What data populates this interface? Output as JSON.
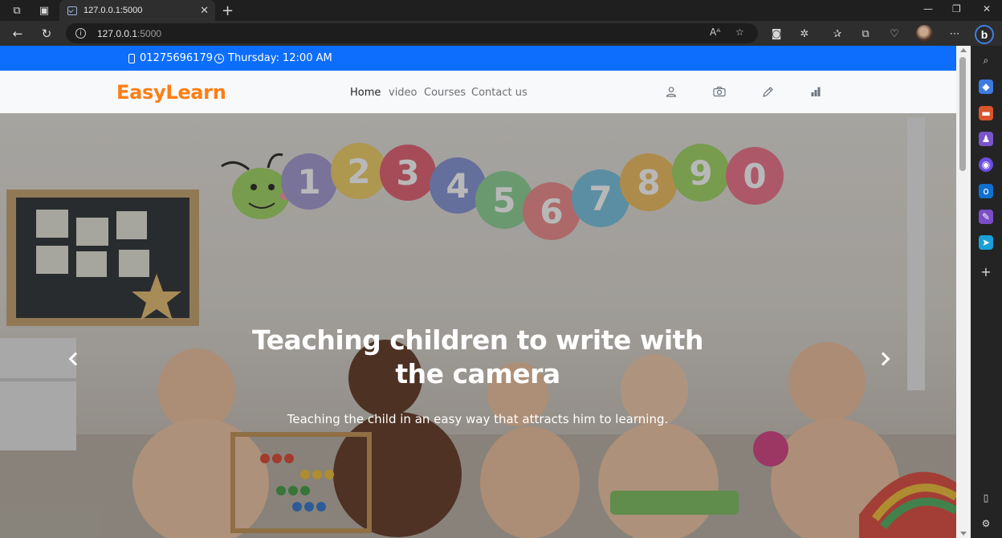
{
  "browser": {
    "tab_title": "127.0.0.1:5000",
    "url_host": "127.0.0.1",
    "url_port": ":5000"
  },
  "topbar": {
    "phone": "01275696179",
    "datetime": "Thursday: 12:00 AM"
  },
  "navbar": {
    "brand": "EasyLearn",
    "links": [
      "Home",
      "video",
      "Courses",
      "Contact us"
    ],
    "active_link": "Home",
    "icons": [
      "person-icon",
      "camera-icon",
      "pencil-icon",
      "bar-chart-icon"
    ]
  },
  "hero": {
    "title": "Teaching children to write with the camera",
    "subtitle": "Teaching the child in an easy way that attracts him to learning.",
    "wall_numbers": [
      "1",
      "2",
      "3",
      "4",
      "5",
      "6",
      "7",
      "8",
      "9",
      "0"
    ]
  },
  "colors": {
    "topbar_bg": "#0d6efd",
    "brand": "#fd7e14",
    "navbar_bg": "#f8f9fa"
  }
}
